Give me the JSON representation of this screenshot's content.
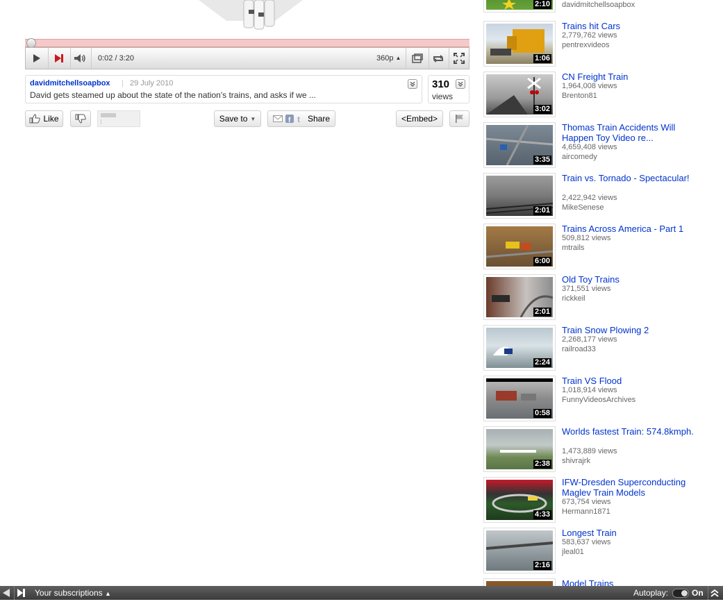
{
  "player": {
    "time": "0:02 / 3:20",
    "quality": "360p",
    "progress_fraction": 0.01,
    "brand_color": "#cc181e"
  },
  "info": {
    "owner": "davidmitchellsoapbox",
    "separator": "|",
    "date": "29 July 2010",
    "description": "David gets steamed up about the state of the nation's trains, and asks if we ...",
    "views_count": "310",
    "views_label": "views"
  },
  "actions": {
    "like": "Like",
    "save_to": "Save to",
    "share": "Share",
    "embed": "<Embed>"
  },
  "sidebar": {
    "partial_top_channel": "davidmitchellsoapbox",
    "partial_top_duration": "2:10",
    "videos": [
      {
        "title": "Trains hit Cars",
        "views": "2,779,762 views",
        "channel": "pentrexvideos",
        "duration": "1:06"
      },
      {
        "title": "CN Freight Train",
        "views": "1,964,008 views",
        "channel": "Brenton81",
        "duration": "3:02"
      },
      {
        "title": "Thomas Train Accidents Will Happen Toy Video re...",
        "views": "4,659,408 views",
        "channel": "aircomedy",
        "duration": "3:35"
      },
      {
        "title": "Train vs. Tornado - Spectacular!",
        "views": "2,422,942 views",
        "channel": "MikeSenese",
        "duration": "2:01"
      },
      {
        "title": "Trains Across America - Part 1",
        "views": "509,812 views",
        "channel": "mtrails",
        "duration": "6:00"
      },
      {
        "title": "Old Toy Trains",
        "views": "371,551 views",
        "channel": "rickkeil",
        "duration": "2:01"
      },
      {
        "title": "Train Snow Plowing 2",
        "views": "2,268,177 views",
        "channel": "railroad33",
        "duration": "2:24"
      },
      {
        "title": "Train VS Flood",
        "views": "1,018,914 views",
        "channel": "FunnyVideosArchives",
        "duration": "0:58"
      },
      {
        "title": "Worlds fastest Train: 574.8kmph.",
        "views": "1,473,889 views",
        "channel": "shivrajrk",
        "duration": "2:38"
      },
      {
        "title": "IFW-Dresden Superconducting Maglev Train Models",
        "views": "673,754 views",
        "channel": "Hermann1871",
        "duration": "4:33"
      },
      {
        "title": "Longest Train",
        "views": "583,637 views",
        "channel": "jleal01",
        "duration": "2:16"
      }
    ],
    "partial_bottom_title": "Model Trains"
  },
  "bottombar": {
    "subscriptions": "Your subscriptions",
    "autoplay_label": "Autoplay:",
    "autoplay_state": "On"
  }
}
